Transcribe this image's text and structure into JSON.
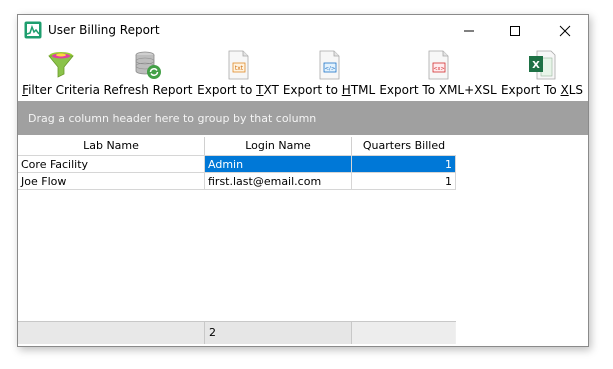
{
  "window": {
    "title": "User Billing Report"
  },
  "toolbar": {
    "buttons": [
      {
        "pre": "",
        "mnemonic": "F",
        "post": "ilter Criteria",
        "icon": "funnel-icon"
      },
      {
        "pre": "",
        "mnemonic": "",
        "post": "Refresh Report",
        "icon": "refresh-database-icon"
      },
      {
        "pre": "Export to ",
        "mnemonic": "T",
        "post": "XT",
        "icon": "txt-file-icon"
      },
      {
        "pre": "Export to ",
        "mnemonic": "H",
        "post": "TML",
        "icon": "html-file-icon"
      },
      {
        "pre": "Export To XML+XSL",
        "mnemonic": "",
        "post": "",
        "icon": "xml-file-icon"
      },
      {
        "pre": "Export To ",
        "mnemonic": "X",
        "post": "LS",
        "icon": "excel-file-icon"
      }
    ]
  },
  "group_hint": "Drag a column header here to group by that column",
  "table": {
    "columns": [
      "Lab Name",
      "Login Name",
      "Quarters Billed"
    ],
    "rows": [
      {
        "lab": "Core Facility",
        "login": "Admin",
        "quarters": "1",
        "selected": true
      },
      {
        "lab": "Joe Flow",
        "login": "first.last@email.com",
        "quarters": "1",
        "selected": false
      }
    ]
  },
  "footer": {
    "count": "2"
  },
  "colors": {
    "selection": "#0078d7",
    "group_bar": "#a0a0a0"
  }
}
